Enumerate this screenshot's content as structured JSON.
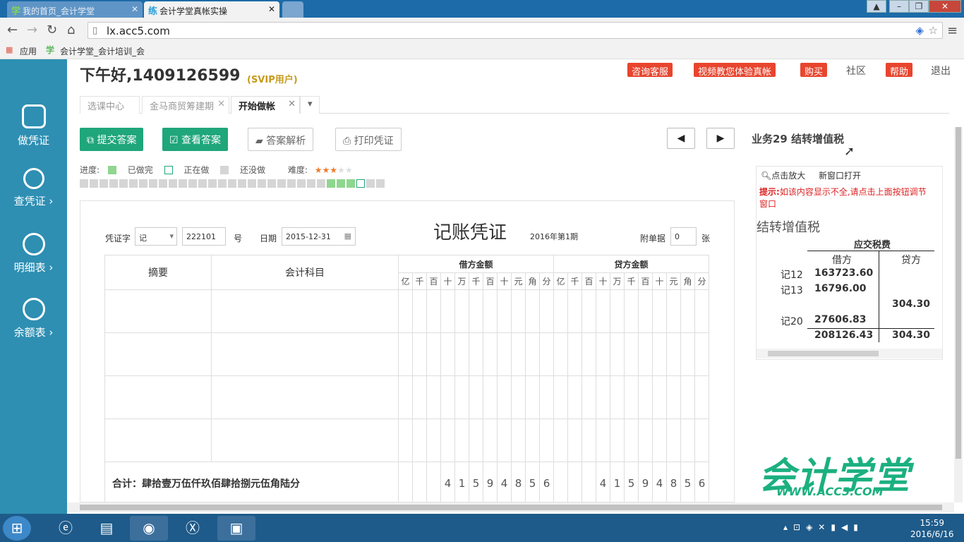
{
  "browser": {
    "tabs": [
      {
        "icon": "学",
        "title": "我的首页_会计学堂"
      },
      {
        "icon": "练",
        "title": "会计学堂真帐实操"
      }
    ],
    "url": "lx.acc5.com",
    "bookmarks": [
      {
        "label": "应用"
      },
      {
        "label": "会计学堂_会计培训_会"
      }
    ]
  },
  "sidebar": {
    "items": [
      {
        "label": "做凭证",
        "icon": "calendar-icon"
      },
      {
        "label": "查凭证 ›",
        "icon": "search-icon"
      },
      {
        "label": "明细表 ›",
        "icon": "list-icon"
      },
      {
        "label": "余额表 ›",
        "icon": "list-icon"
      }
    ]
  },
  "header": {
    "greeting": "下午好,1409126599",
    "svip": "(SVIP用户)",
    "buttons": [
      "咨询客服",
      "视频教您体验真帐",
      "购买",
      "帮助"
    ],
    "links": [
      "社区",
      "退出"
    ]
  },
  "page_tabs": [
    {
      "label": "选课中心"
    },
    {
      "label": "金马商贸筹建期"
    },
    {
      "label": "开始做帐"
    }
  ],
  "actions": {
    "submit": "提交答案",
    "view": "查看答案",
    "analysis": "答案解析",
    "print": "打印凭证"
  },
  "business_label": "业务29 结转增值税",
  "progress": {
    "label": "进度:",
    "done": "已做完",
    "doing": "正在做",
    "todo": "还没做",
    "difficulty": "难度:",
    "difficulty_stars": 3,
    "total_cells": 31,
    "done_cells": [
      25,
      26,
      27
    ],
    "current_cell": 28,
    "colors": {
      "done": "#8fd68f",
      "current": "#ffffff",
      "todo": "#d5d5d5"
    }
  },
  "voucher": {
    "title": "记账凭证",
    "period": "2016年第1期",
    "type_label": "凭证字",
    "type_value": "记",
    "number_value": "222101",
    "number_unit": "号",
    "date_label": "日期",
    "date_value": "2015-12-31",
    "attach_label": "附单据",
    "attach_value": "0",
    "attach_unit": "张",
    "col_summary": "摘要",
    "col_account": "会计科目",
    "col_debit": "借方金额",
    "col_credit": "贷方金额",
    "digits": [
      "亿",
      "千",
      "百",
      "十",
      "万",
      "千",
      "百",
      "十",
      "元",
      "角",
      "分"
    ],
    "total_label": "合计：肆拾壹万伍仟玖佰肆拾捌元伍角陆分",
    "debit_total_digits": [
      "",
      "",
      "",
      "4",
      "1",
      "5",
      "9",
      "4",
      "8",
      "5",
      "6"
    ],
    "credit_total_digits": [
      "",
      "",
      "",
      "4",
      "1",
      "5",
      "9",
      "4",
      "8",
      "5",
      "6"
    ]
  },
  "right_panel": {
    "zoom": "点击放大",
    "new_window": "新窗口打开",
    "hint_prefix": "提示:",
    "hint": "如该内容显示不全,请点击上面按钮调节窗口",
    "title": "结转增值税",
    "account": "应交税费",
    "debit_header": "借方",
    "credit_header": "贷方",
    "rows": [
      {
        "ref": "记12",
        "debit": "163723.60",
        "credit": ""
      },
      {
        "ref": "记13",
        "debit": "16796.00",
        "credit": ""
      },
      {
        "ref": "",
        "debit": "",
        "credit": "304.30"
      },
      {
        "ref": "记20",
        "debit": "27606.83",
        "credit": ""
      }
    ],
    "total_debit": "208126.43",
    "total_credit": "304.30"
  },
  "logo": {
    "text": "会计学堂",
    "url": "WWW.ACC5.COM"
  },
  "taskbar": {
    "time": "15:59",
    "date": "2016/6/16"
  }
}
